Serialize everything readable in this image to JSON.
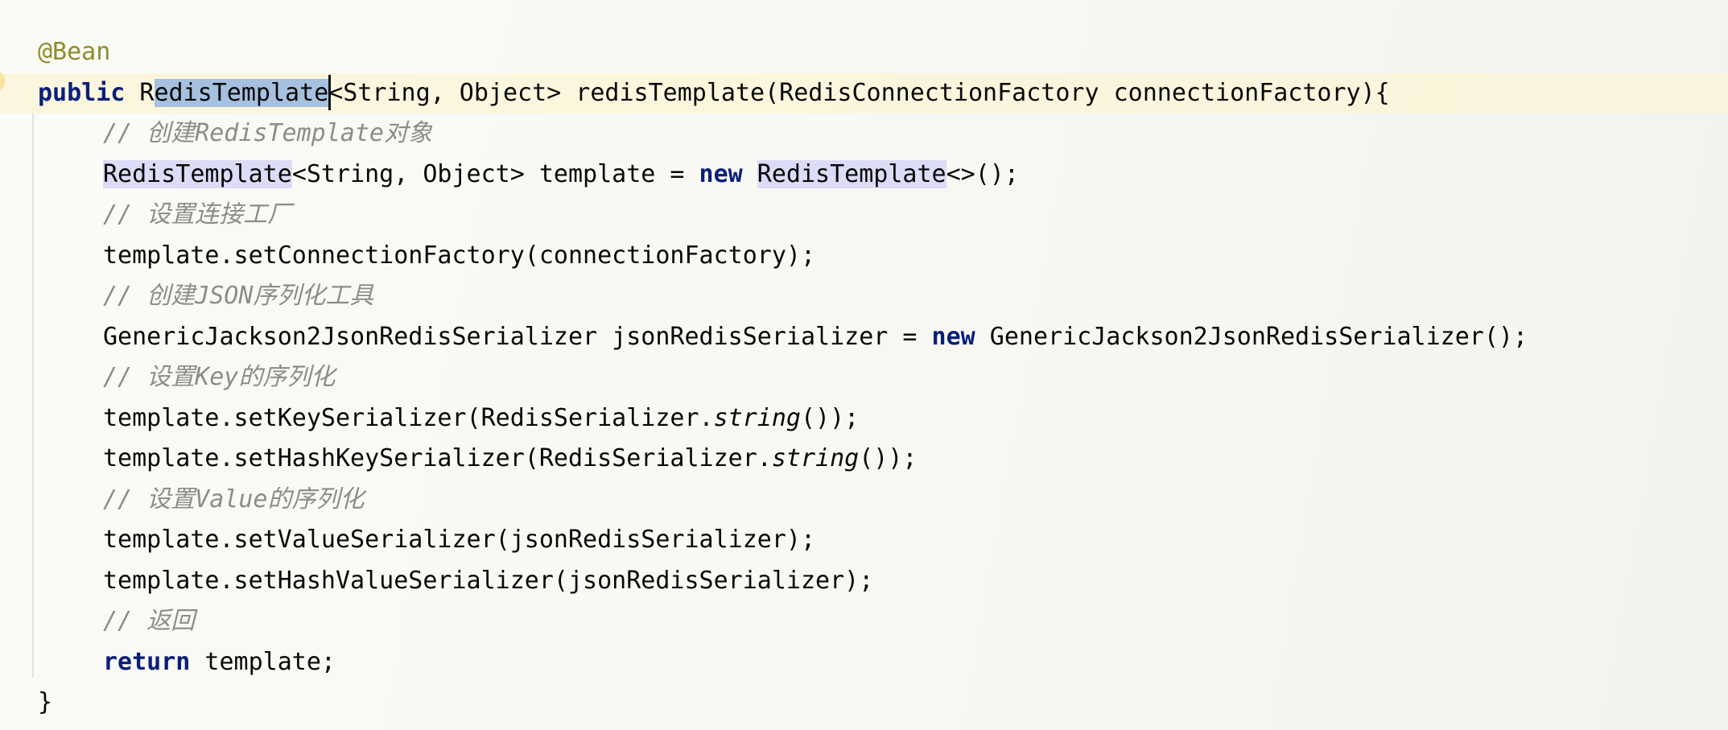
{
  "editor": {
    "lines": [
      {
        "parts": [
          {
            "t": "@Bean",
            "c": "ann"
          }
        ]
      },
      {
        "current": true,
        "parts": [
          {
            "t": "public",
            "c": "kw"
          },
          {
            "t": " R"
          },
          {
            "t": "edisTemplate",
            "c": "sel"
          },
          {
            "t": "<String, Object> redisTemplate(RedisConnectionFactory connectionFactory){"
          }
        ]
      },
      {
        "indent": true,
        "parts": [
          {
            "t": "// 创建RedisTemplate对象",
            "c": "cm"
          }
        ]
      },
      {
        "indent": true,
        "parts": [
          {
            "t": "RedisTemplate",
            "c": "hl"
          },
          {
            "t": "<String, Object> template = "
          },
          {
            "t": "new",
            "c": "kw"
          },
          {
            "t": " "
          },
          {
            "t": "RedisTemplate",
            "c": "hl"
          },
          {
            "t": "<>();"
          }
        ]
      },
      {
        "indent": true,
        "parts": [
          {
            "t": "// 设置连接工厂",
            "c": "cm"
          }
        ]
      },
      {
        "indent": true,
        "parts": [
          {
            "t": "template.setConnectionFactory(connectionFactory);"
          }
        ]
      },
      {
        "indent": true,
        "parts": [
          {
            "t": "// 创建JSON序列化工具",
            "c": "cm"
          }
        ]
      },
      {
        "indent": true,
        "parts": [
          {
            "t": "GenericJackson2JsonRedisSerializer jsonRedisSerializer = "
          },
          {
            "t": "new",
            "c": "kw"
          },
          {
            "t": " GenericJackson2JsonRedisSerializer();"
          }
        ]
      },
      {
        "indent": true,
        "parts": [
          {
            "t": "// 设置Key的序列化",
            "c": "cm"
          }
        ]
      },
      {
        "indent": true,
        "parts": [
          {
            "t": "template.setKeySerializer(RedisSerializer."
          },
          {
            "t": "string",
            "c": "st"
          },
          {
            "t": "());"
          }
        ]
      },
      {
        "indent": true,
        "parts": [
          {
            "t": "template.setHashKeySerializer(RedisSerializer."
          },
          {
            "t": "string",
            "c": "st"
          },
          {
            "t": "());"
          }
        ]
      },
      {
        "indent": true,
        "parts": [
          {
            "t": "// 设置Value的序列化",
            "c": "cm"
          }
        ]
      },
      {
        "indent": true,
        "parts": [
          {
            "t": "template.setValueSerializer(jsonRedisSerializer);"
          }
        ]
      },
      {
        "indent": true,
        "parts": [
          {
            "t": "template.setHashValueSerializer(jsonRedisSerializer);"
          }
        ]
      },
      {
        "indent": true,
        "parts": [
          {
            "t": "// 返回",
            "c": "cm"
          }
        ]
      },
      {
        "indent": true,
        "parts": [
          {
            "t": "return",
            "c": "kw"
          },
          {
            "t": " template;"
          }
        ]
      },
      {
        "parts": [
          {
            "t": "}"
          }
        ]
      }
    ]
  },
  "gutter": {
    "icon": "lightbulb-icon",
    "color": "#f0b400"
  },
  "colors": {
    "keyword": "#0a1f7a",
    "annotation": "#8c8c2e",
    "comment": "#8c8c8c",
    "selection": "#a6c1e0",
    "usage_highlight": "#dcdcf6",
    "current_line": "#fcf4d6"
  }
}
